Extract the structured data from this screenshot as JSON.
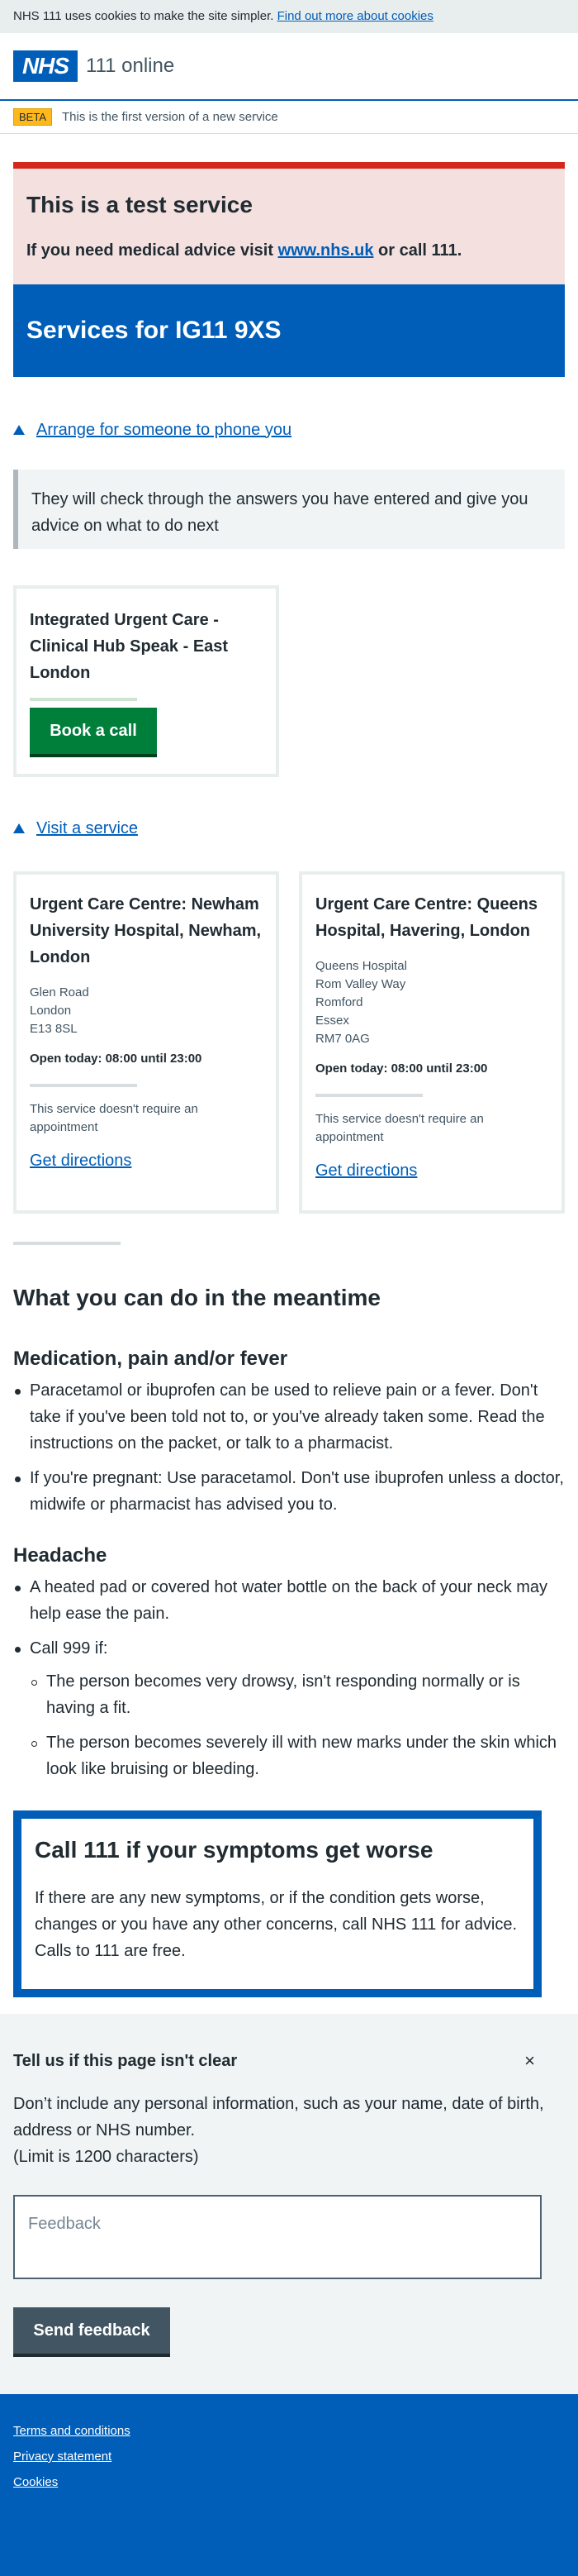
{
  "cookie": {
    "text": "NHS 111 uses cookies to make the site simpler.",
    "link": "Find out more about cookies"
  },
  "header": {
    "logo": "NHS",
    "service": "111 online"
  },
  "beta": {
    "tag": "BETA",
    "text": "This is the first version of a new service"
  },
  "test_banner": {
    "title": "This is a test service",
    "text_before": "If you need medical advice visit ",
    "link": "www.nhs.uk",
    "text_after": " or call 111."
  },
  "services": {
    "title": "Services for IG11 9XS"
  },
  "phone_section": {
    "toggle": "Arrange for someone to phone you",
    "inset": "They will check through the answers you have entered and give you advice on what to do next",
    "card": {
      "title": "Integrated Urgent Care - Clinical Hub Speak - East London",
      "button": "Book a call"
    }
  },
  "visit_section": {
    "toggle": "Visit a service",
    "cards": [
      {
        "title": "Urgent Care Centre: Newham University Hospital, Newham, London",
        "address": [
          "Glen Road",
          "London",
          "E13 8SL"
        ],
        "open": "Open today: 08:00 until 23:00",
        "note": "This service doesn't require an appointment",
        "link": "Get directions"
      },
      {
        "title": "Urgent Care Centre: Queens Hospital, Havering, London",
        "address": [
          "Queens Hospital",
          "Rom Valley Way",
          "Romford",
          "Essex",
          "RM7 0AG"
        ],
        "open": "Open today: 08:00 until 23:00",
        "note": "This service doesn't require an appointment",
        "link": "Get directions"
      }
    ]
  },
  "meantime": {
    "title": "What you can do in the meantime",
    "med_title": "Medication, pain and/or fever",
    "med_items": [
      "Paracetamol or ibuprofen can be used to relieve pain or a fever. Don't take if you've been told not to, or you've already taken some. Read the instructions on the packet, or talk to a pharmacist.",
      "If you're pregnant: Use paracetamol. Don't use ibuprofen unless a doctor, midwife or pharmacist has advised you to."
    ],
    "head_title": "Headache",
    "head_items": [
      "A heated pad or covered hot water bottle on the back of your neck may help ease the pain.",
      "Call 999 if:"
    ],
    "call999_items": [
      "The person becomes very drowsy, isn't responding normally or is having a fit.",
      "The person becomes severely ill with new marks under the skin which look like bruising or bleeding."
    ]
  },
  "care": {
    "title": "Call 111 if your symptoms get worse",
    "text": "If there are any new symptoms, or if the condition gets worse, changes or you have any other concerns, call NHS 111 for advice. Calls to 111 are free."
  },
  "feedback": {
    "title": "Tell us if this page isn't clear",
    "close": "×",
    "text": "Don’t include any personal information, such as your name, date of birth, address or NHS number.",
    "limit": "(Limit is 1200 characters)",
    "placeholder": "Feedback",
    "button": "Send feedback"
  },
  "footer": {
    "links": [
      "Terms and conditions",
      "Privacy statement",
      "Cookies"
    ]
  },
  "colors": {
    "nhs_blue": "#005eb8",
    "green": "#007f3b",
    "red": "#d5281b",
    "yellow": "#ffb81c"
  }
}
